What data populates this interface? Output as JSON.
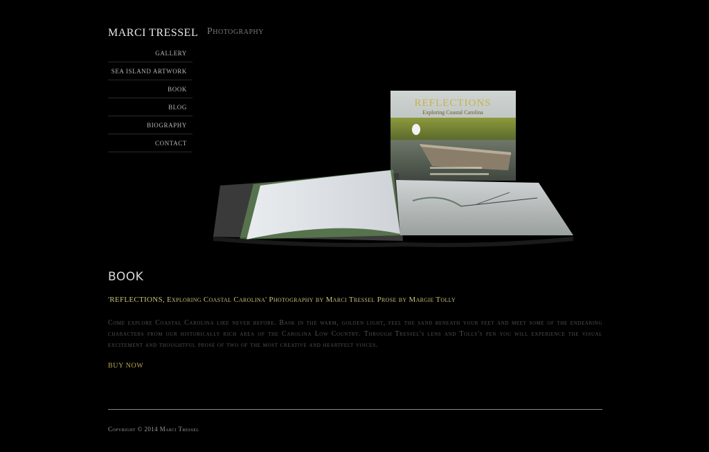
{
  "brand": "MARCI TRESSEL",
  "section": "Photography",
  "nav": [
    {
      "label": "GALLERY"
    },
    {
      "label": "SEA ISLAND ARTWORK"
    },
    {
      "label": "BOOK"
    },
    {
      "label": "BLOG"
    },
    {
      "label": "BIOGRAPHY"
    },
    {
      "label": "CONTACT"
    }
  ],
  "hero": {
    "cover_title": "REFLECTIONS",
    "cover_subtitle": "Exploring Coastal Carolina"
  },
  "book": {
    "heading": "BOOK",
    "subtitle": "'REFLECTIONS, Exploring Coastal Carolina' Photography by Marci Tressel Prose by Margie Tolly",
    "description": "Come explore Coastal Carolina like never before. Bask in the warm, golden light, feel the sand beneath your feet and meet some of the endearing characters from our historically rich area of the Carolina Low Country. Through Tressel's lens and Tolly's pen you will experience the visual excitement and thoughtful prose of two of the most creative and heartfelt voices.",
    "buy_label": "BUY NOW"
  },
  "footer": {
    "copyright": "Copyright © 2014 Marci Tressel"
  }
}
